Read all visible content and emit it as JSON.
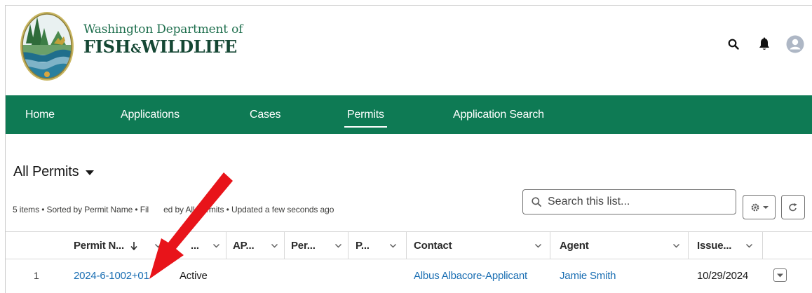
{
  "header": {
    "agency_line1": "Washington Department of",
    "agency_line2_a": "FISH",
    "agency_line2_amp": "&",
    "agency_line2_b": "WILDLIFE",
    "icons": [
      "search-icon",
      "bell-icon",
      "user-avatar-icon"
    ]
  },
  "nav": {
    "items": [
      {
        "label": "Home"
      },
      {
        "label": "Applications"
      },
      {
        "label": "Cases"
      },
      {
        "label": "Permits"
      },
      {
        "label": "Application Search"
      }
    ],
    "active": "Permits"
  },
  "list": {
    "title": "All Permits",
    "meta_before": "5 items • Sorted by Permit Name • Fil",
    "meta_after": "ed by All permits • Updated a few seconds ago",
    "search_placeholder": "Search this list..."
  },
  "table": {
    "columns": [
      {
        "label": "Permit N...",
        "sorted": "desc"
      },
      {
        "label": "...",
        "sorted": ""
      },
      {
        "label": "AP...",
        "sorted": ""
      },
      {
        "label": "Per...",
        "sorted": ""
      },
      {
        "label": "P...",
        "sorted": ""
      },
      {
        "label": "Contact",
        "sorted": ""
      },
      {
        "label": "Agent",
        "sorted": ""
      },
      {
        "label": "Issue...",
        "sorted": ""
      }
    ],
    "rows": [
      {
        "num": "1",
        "permit_name": "2024-6-1002+01",
        "status": "Active",
        "contact": "Albus Albacore-Applicant",
        "agent": "Jamie Smith",
        "issue_date": "10/29/2024"
      }
    ]
  },
  "colors": {
    "nav_green": "#0e7a54",
    "link_blue": "#1b6fb3",
    "annotation_arrow": "#e8141a"
  }
}
